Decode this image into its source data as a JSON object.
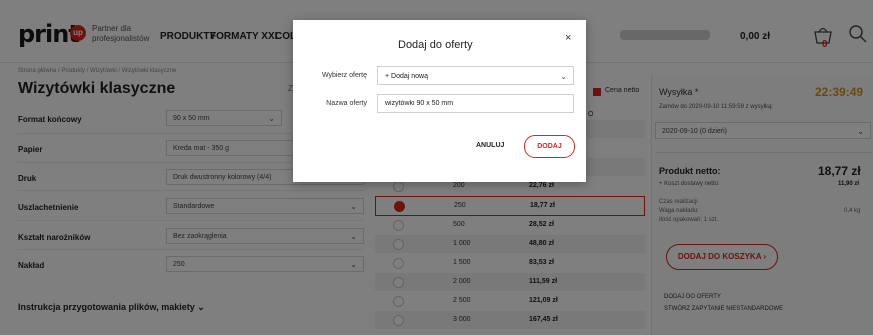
{
  "header": {
    "logo_text": "print",
    "logo_badge": "up",
    "tagline": "Partner dla profesjonalistów",
    "nav": [
      "PRODUKTY",
      "FORMATY XXL",
      "COL"
    ],
    "cart_total": "0,00 zł",
    "cart_count": "0"
  },
  "breadcrumb": "Strona główna / Produkty / Wizytówki / Wizytówki klasyczne",
  "page_title": "Wizytówki klasyczne",
  "title_side_hint": "Z",
  "options": [
    {
      "label": "Format końcowy",
      "value": "90 x 50 mm"
    },
    {
      "label": "Papier",
      "value": "Kreda mat - 350 g"
    },
    {
      "label": "Druk",
      "value": "Druk dwustronny kolorowy (4/4)"
    },
    {
      "label": "Uszlachetnienie",
      "value": "Standardowe"
    },
    {
      "label": "Kształt narożników",
      "value": "Bez zaokrąglenia"
    },
    {
      "label": "Nakład",
      "value": "250"
    }
  ],
  "instructions_label": "Instrukcja przygotowania plików, makiety",
  "price_table": {
    "netto_label": "Cena netto",
    "column_suffix": "O",
    "rows": [
      {
        "qty": "200",
        "price": "22,76 zł",
        "selected": false
      },
      {
        "qty": "250",
        "price": "18,77 zł",
        "selected": true
      },
      {
        "qty": "500",
        "price": "28,52 zł",
        "selected": false
      },
      {
        "qty": "1 000",
        "price": "48,80 zł",
        "selected": false
      },
      {
        "qty": "1 500",
        "price": "83,53 zł",
        "selected": false
      },
      {
        "qty": "2 000",
        "price": "111,59 zł",
        "selected": false
      },
      {
        "qty": "2 500",
        "price": "121,09 zł",
        "selected": false
      },
      {
        "qty": "3 000",
        "price": "167,45 zł",
        "selected": false
      }
    ]
  },
  "sidebar": {
    "shipping_label": "Wysyłka *",
    "timer": "22:39:49",
    "order_by": "Zamów do 2020-09-10 11:59:59 z wysyłką:",
    "date_option": "2020-09-10 (0 dzień)",
    "net_product_label": "Produkt netto:",
    "net_product_value": "18,77 zł",
    "shipping_cost_label": "+ Koszt dostawy netto:",
    "shipping_cost_value": "11,90 zł",
    "lead_time_label": "Czas realizacji",
    "weight_label": "Waga nakładu:",
    "weight_value": "0,4 kg",
    "packages_label": "Ilość opakowań: 1 szt.",
    "add_to_cart": "DODAJ DO KOSZYKA",
    "add_to_offer": "DODAJ DO OFERTY",
    "custom_request": "STWÓRZ ZAPYTANIE NIESTANDARDOWE"
  },
  "modal": {
    "title": "Dodaj do oferty",
    "select_label": "Wybierz ofertę",
    "select_value": "+ Dodaj nową",
    "name_label": "Nazwa oferty",
    "name_value": "wizytówki 90 x 50 mm",
    "cancel": "ANULUJ",
    "confirm": "DODAJ"
  },
  "colors": {
    "accent": "#d8261f",
    "timer": "#d79020"
  }
}
